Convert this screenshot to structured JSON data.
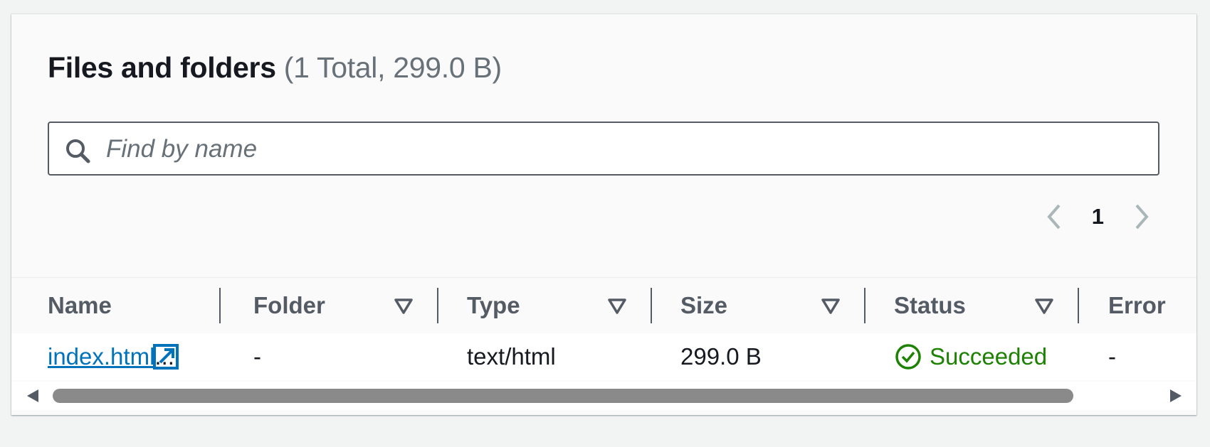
{
  "panel": {
    "title": "Files and folders",
    "counter": "(1 Total, 299.0 B)"
  },
  "search": {
    "placeholder": "Find by name",
    "value": ""
  },
  "pagination": {
    "current_page": "1",
    "prev_icon": "chevron-left-icon",
    "next_icon": "chevron-right-icon"
  },
  "table": {
    "columns": [
      "Name",
      "Folder",
      "Type",
      "Size",
      "Status",
      "Error"
    ],
    "rows": [
      {
        "name": "index.html",
        "ellipsis": "...",
        "folder": "-",
        "type": "text/html",
        "size": "299.0 B",
        "status": "Succeeded",
        "error": "-"
      }
    ]
  },
  "colors": {
    "link": "#0073bb",
    "success": "#1d8102",
    "text_secondary": "#687078"
  }
}
